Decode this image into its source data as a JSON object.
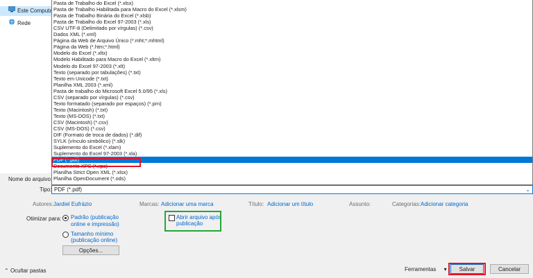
{
  "nav": {
    "items": [
      {
        "label": "Este Computador",
        "icon": "computer-icon",
        "selected": true
      },
      {
        "label": "Rede",
        "icon": "network-icon",
        "selected": false
      }
    ]
  },
  "file_types": [
    "Pasta de Trabalho do Excel (*.xlsx)",
    "Pasta de Trabalho Habilitada para Macro do Excel (*.xlsm)",
    "Pasta de Trabalho Binária do Excel (*.xlsb)",
    "Pasta de Trabalho do Excel 97-2003 (*.xls)",
    "CSV UTF-8 (Delimitado por vírgulas) (*.csv)",
    "Dados XML (*.xml)",
    "Página da Web de Arquivo Único (*.mht;*.mhtml)",
    "Página da Web (*.htm;*.html)",
    "Modelo do Excel (*.xltx)",
    "Modelo Habilitado para Macro do Excel (*.xltm)",
    "Modelo do Excel 97-2003 (*.xlt)",
    "Texto (separado por tabulações) (*.txt)",
    "Texto em Unicode (*.txt)",
    "Planilha XML 2003 (*.xml)",
    "Pasta de trabalho do Microsoft Excel 5.0/95 (*.xls)",
    "CSV (separado por vírgulas) (*.csv)",
    "Texto formatado (separado por espaços) (*.prn)",
    "Texto (Macintosh) (*.txt)",
    "Texto (MS-DOS) (*.txt)",
    "CSV (Macintosh) (*.csv)",
    "CSV (MS-DOS) (*.csv)",
    "DIF (Formato de troca de dados) (*.dif)",
    "SYLK (vínculo simbólico) (*.slk)",
    "Suplemento do Excel (*.xlam)",
    "Suplemento do Excel 97-2003 (*.xla)",
    "PDF (*.pdf)",
    "Documento XPS (*.xps)",
    "Planilha Strict Open XML (*.xlsx)",
    "Planilha OpenDocument (*.ods)"
  ],
  "selected_type_index": 25,
  "form": {
    "filename_label": "Nome do arquivo:",
    "type_label": "Tipo:",
    "type_value": "PDF (*.pdf)"
  },
  "meta": {
    "authors_label": "Autores:",
    "authors_value": "Jardiel Eufrázio",
    "tags_label": "Marcas:",
    "tags_value": "Adicionar uma marca",
    "title_label": "Título:",
    "title_value": "Adicionar um título",
    "subject_label": "Assunto:",
    "categories_label": "Categorias:",
    "categories_value": "Adicionar categoria"
  },
  "optimize": {
    "label": "Otimizar para:",
    "standard_line1": "Padrão (publicação",
    "standard_line2": "online e impressão)",
    "minimum_line1": "Tamanho mínimo",
    "minimum_line2": "(publicação online)",
    "options_button": "Opções..."
  },
  "open_after": {
    "line1": "Abrir arquivo após",
    "line2": "publicação"
  },
  "footer": {
    "hide_folders": "Ocultar pastas",
    "tools": "Ferramentas",
    "save": "Salvar",
    "cancel": "Cancelar"
  },
  "colors": {
    "selection": "#0078d7",
    "highlight_red": "#e81123",
    "highlight_green": "#23a635",
    "link": "#0066cc"
  }
}
